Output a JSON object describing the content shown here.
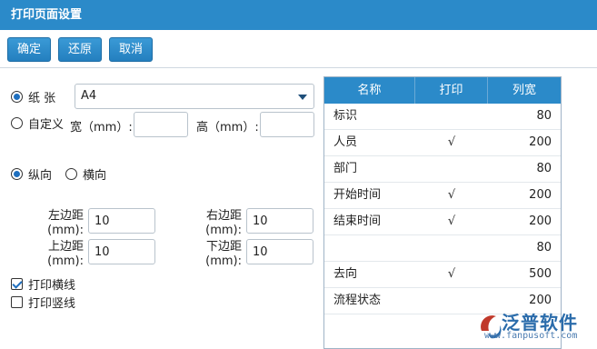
{
  "title": "打印页面设置",
  "toolbar": {
    "ok": "确定",
    "reset": "还原",
    "cancel": "取消"
  },
  "paper": {
    "label": "纸 张",
    "selected": "A4"
  },
  "custom": {
    "label": "自定义",
    "width_label": "宽（mm）:",
    "height_label": "高（mm）:",
    "width_value": "",
    "height_value": ""
  },
  "orientation": {
    "portrait": "纵向",
    "landscape": "横向",
    "selected": "portrait"
  },
  "margins": {
    "left_label_1": "左边距",
    "left_label_2": "(mm):",
    "left_value": "10",
    "right_label_1": "右边距",
    "right_label_2": "(mm):",
    "right_value": "10",
    "top_label_1": "上边距",
    "top_label_2": "(mm):",
    "top_value": "10",
    "bottom_label_1": "下边距",
    "bottom_label_2": "(mm):",
    "bottom_value": "10"
  },
  "options": {
    "hlines": "打印横线",
    "hlines_checked": true,
    "vlines": "打印竖线",
    "vlines_checked": false
  },
  "grid": {
    "headers": [
      "名称",
      "打印",
      "列宽"
    ],
    "rows": [
      {
        "name": "标识",
        "print": "",
        "width": "80"
      },
      {
        "name": "人员",
        "print": "√",
        "width": "200"
      },
      {
        "name": "部门",
        "print": "",
        "width": "80"
      },
      {
        "name": "开始时间",
        "print": "√",
        "width": "200"
      },
      {
        "name": "结束时间",
        "print": "√",
        "width": "200"
      },
      {
        "name": "",
        "print": "",
        "width": "80"
      },
      {
        "name": "去向",
        "print": "√",
        "width": "500"
      },
      {
        "name": "流程状态",
        "print": "",
        "width": "200"
      }
    ]
  },
  "logo": {
    "text": "泛普软件",
    "url": "www.fanpusoft.com"
  },
  "colors": {
    "header_blue": "#2b8ac9",
    "accent": "#1e6fbf"
  }
}
